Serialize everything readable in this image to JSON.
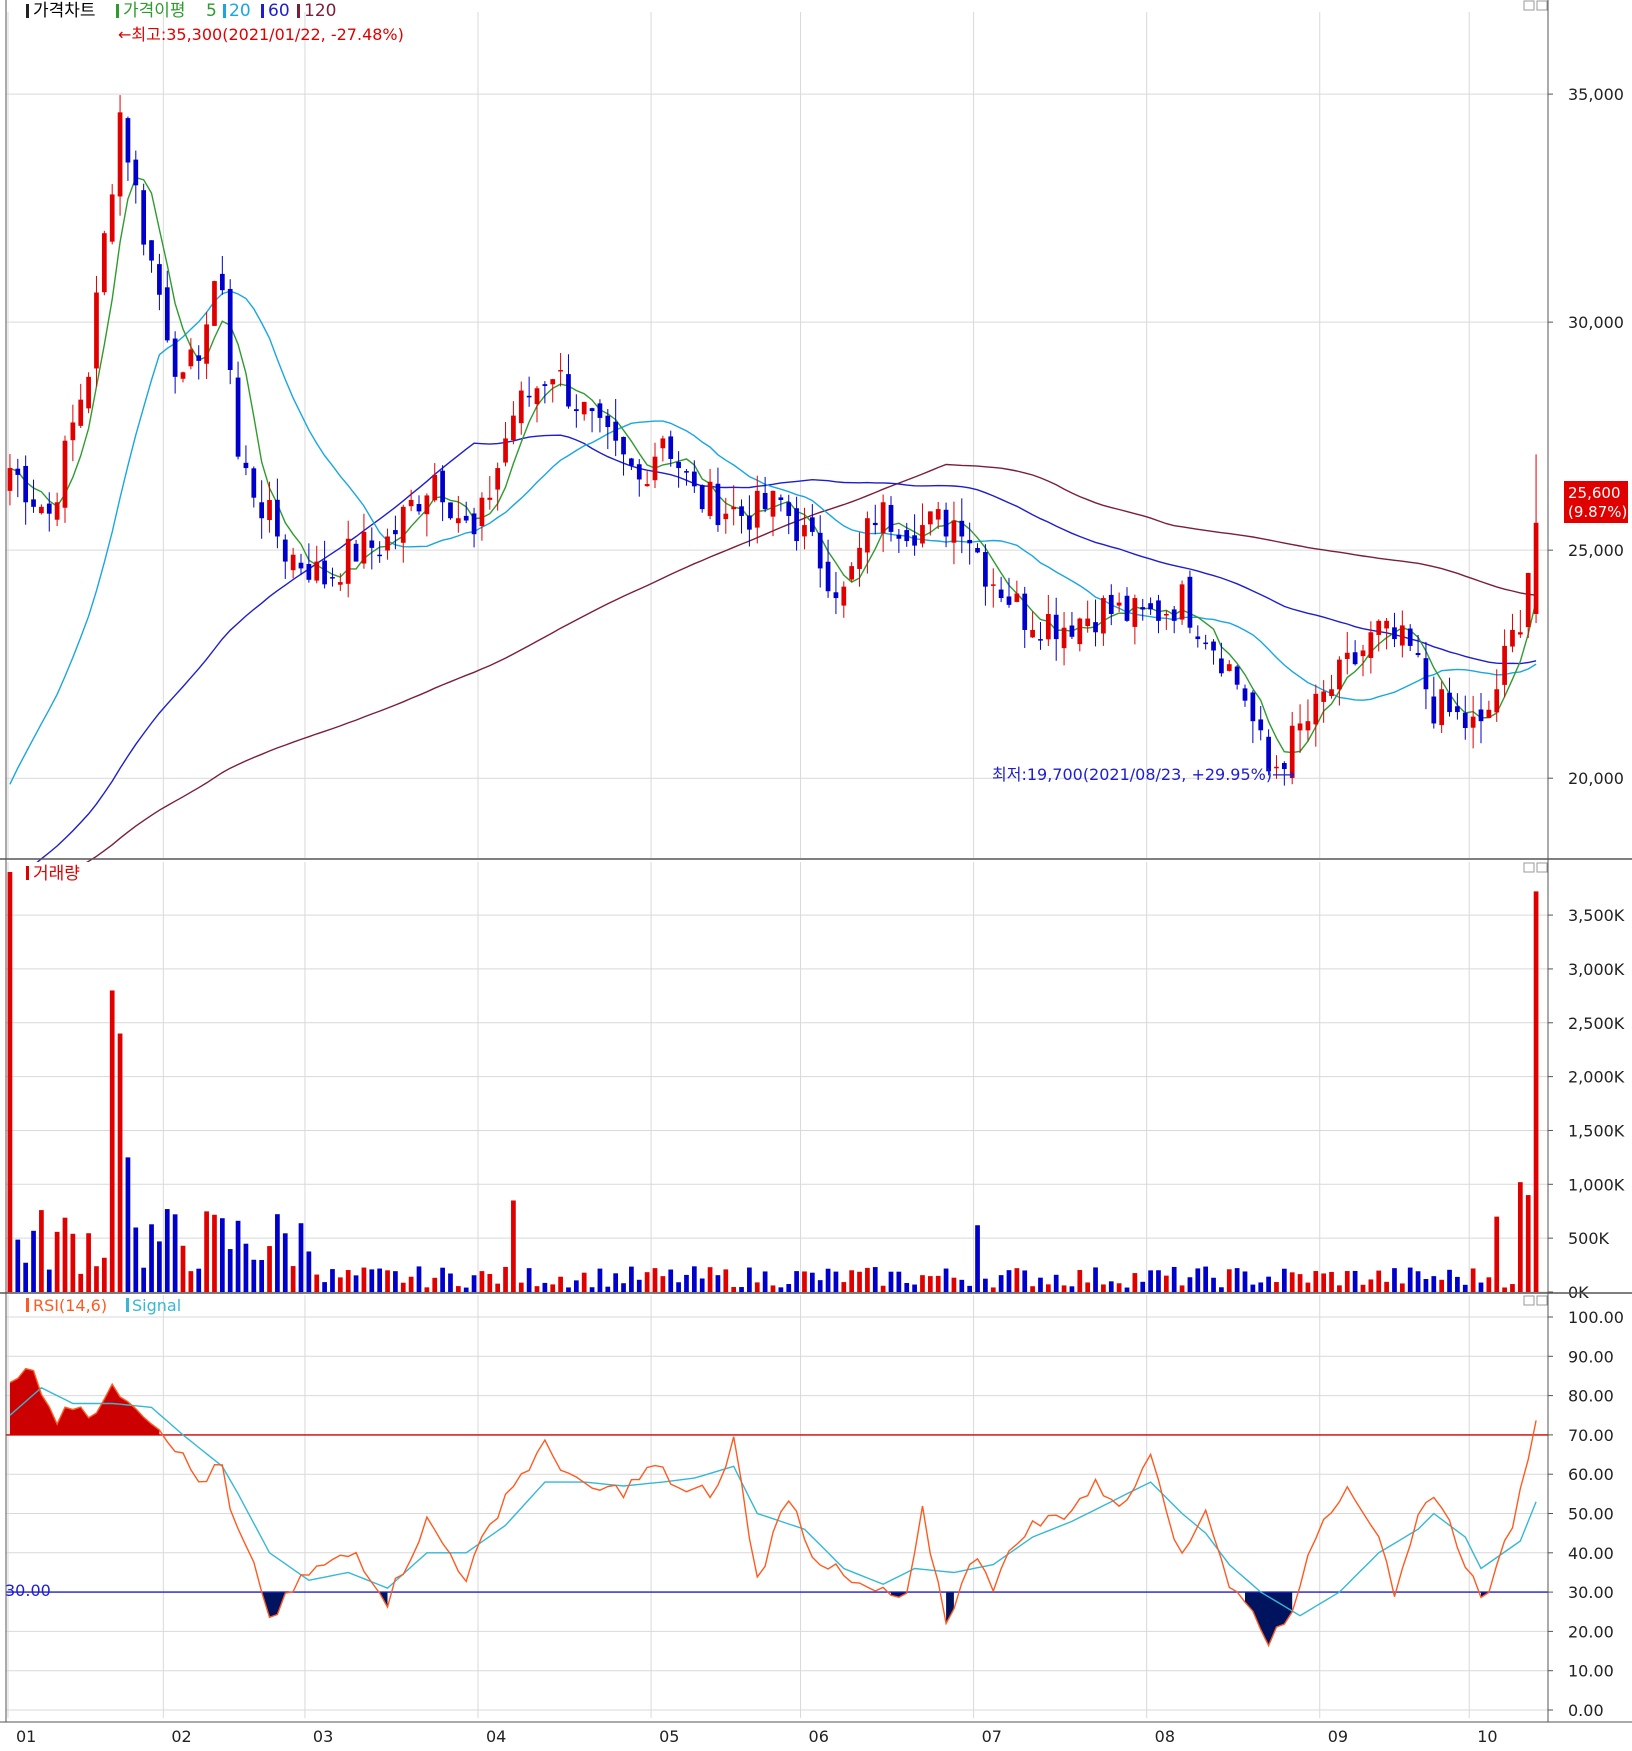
{
  "colors": {
    "up": "#e00000",
    "down": "#0000cc",
    "ma5": "#2e9b2e",
    "ma20": "#1aa6e0",
    "ma60": "#1e1ed0",
    "ma120": "#7a1f3a",
    "grid": "#d9d9d9",
    "frame": "#555555",
    "rsi": "#ff5a1f",
    "signal": "#35b8d6",
    "rsi_high": "#cc0000",
    "rsi_low": "#00135e",
    "axis_text": "#222222"
  },
  "price_panel": {
    "legend": {
      "title": "가격차트",
      "ma_label": "가격이평",
      "ma5": "5",
      "ma20": "20",
      "ma60": "60",
      "ma120": "120"
    },
    "high_annotation": "←최고:35,300(2021/01/22, -27.48%)",
    "low_annotation": "최저:19,700(2021/08/23, +29.95%)⟶",
    "current_price": "25,600",
    "current_change": "(9.87%)"
  },
  "volume_panel": {
    "title": "거래량"
  },
  "rsi_panel": {
    "legend_rsi": "RSI(14,6)",
    "legend_signal": "Signal",
    "low_line_label": "30.00"
  },
  "chart_data": [
    {
      "type": "candlestick",
      "title": "가격차트",
      "ylim": [
        18250,
        36800
      ],
      "y_ticks": [
        "35,000",
        "30,000",
        "25,000",
        "20,000"
      ],
      "x_ticks": [
        "01",
        "02",
        "03",
        "04",
        "05",
        "06",
        "07",
        "08",
        "09",
        "10"
      ],
      "x_tick_dates": [
        "2021-01",
        "2021-02",
        "2021-03",
        "2021-04",
        "2021-05",
        "2021-06",
        "2021-07",
        "2021-08",
        "2021-09",
        "2021-10"
      ],
      "close_anchors": [
        [
          "2021-01-04",
          26800
        ],
        [
          "2021-01-11",
          25800
        ],
        [
          "2021-01-18",
          29000
        ],
        [
          "2021-01-22",
          34600
        ],
        [
          "2021-01-27",
          32000
        ],
        [
          "2021-02-03",
          28500
        ],
        [
          "2021-02-10",
          31000
        ],
        [
          "2021-02-16",
          27000
        ],
        [
          "2021-02-24",
          25000
        ],
        [
          "2021-03-04",
          24400
        ],
        [
          "2021-03-10",
          25000
        ],
        [
          "2021-03-16",
          25200
        ],
        [
          "2021-03-24",
          26700
        ],
        [
          "2021-03-31",
          25200
        ],
        [
          "2021-04-07",
          28000
        ],
        [
          "2021-04-14",
          29000
        ],
        [
          "2021-04-22",
          27500
        ],
        [
          "2021-04-29",
          26500
        ],
        [
          "2021-05-04",
          27600
        ],
        [
          "2021-05-11",
          26200
        ],
        [
          "2021-05-20",
          25800
        ],
        [
          "2021-05-27",
          26000
        ],
        [
          "2021-06-03",
          24800
        ],
        [
          "2021-06-08",
          24000
        ],
        [
          "2021-06-14",
          25800
        ],
        [
          "2021-06-22",
          25500
        ],
        [
          "2021-06-29",
          25700
        ],
        [
          "2021-07-02",
          24600
        ],
        [
          "2021-07-09",
          23600
        ],
        [
          "2021-07-16",
          23400
        ],
        [
          "2021-07-23",
          23700
        ],
        [
          "2021-07-30",
          23500
        ],
        [
          "2021-08-06",
          23900
        ],
        [
          "2021-08-12",
          23000
        ],
        [
          "2021-08-18",
          21800
        ],
        [
          "2021-08-23",
          20100
        ],
        [
          "2021-08-31",
          21500
        ],
        [
          "2021-09-03",
          22200
        ],
        [
          "2021-09-10",
          23200
        ],
        [
          "2021-09-16",
          22800
        ],
        [
          "2021-09-24",
          21600
        ],
        [
          "2021-09-30",
          21200
        ],
        [
          "2021-10-05",
          21000
        ],
        [
          "2021-10-07",
          22000
        ],
        [
          "2021-10-12",
          23600
        ],
        [
          "2021-10-14",
          25600
        ]
      ],
      "series": [
        {
          "name": "5",
          "values": []
        },
        {
          "name": "20",
          "values": []
        },
        {
          "name": "60",
          "values": []
        },
        {
          "name": "120",
          "values": []
        }
      ]
    },
    {
      "type": "bar",
      "title": "거래량",
      "ylim": [
        0,
        3900000
      ],
      "y_ticks": [
        "3,500K",
        "3,000K",
        "2,500K",
        "2,000K",
        "1,500K",
        "1,000K",
        "500K",
        "0K"
      ],
      "notable_values": [
        [
          "2021-01-04",
          3900000
        ],
        [
          "2021-01-21",
          2800000
        ],
        [
          "2021-01-22",
          2400000
        ],
        [
          "2021-01-25",
          1250000
        ],
        [
          "2021-04-07",
          850000
        ],
        [
          "2021-07-01",
          620000
        ],
        [
          "2021-10-07",
          700000
        ],
        [
          "2021-10-12",
          1020000
        ],
        [
          "2021-10-13",
          900000
        ],
        [
          "2021-10-14",
          3720000
        ]
      ]
    },
    {
      "type": "line",
      "title": "RSI(14,6)",
      "ylim": [
        0,
        100
      ],
      "y_ticks": [
        "100.00",
        "90.00",
        "80.00",
        "70.00",
        "60.00",
        "50.00",
        "40.00",
        "30.00",
        "20.00",
        "10.00",
        "0.00"
      ],
      "reference_lines": [
        70,
        30
      ],
      "rsi_anchors": [
        [
          "2021-01-04",
          82
        ],
        [
          "2021-01-06",
          86
        ],
        [
          "2021-01-07",
          86
        ],
        [
          "2021-01-12",
          74
        ],
        [
          "2021-01-15",
          79
        ],
        [
          "2021-01-18",
          75
        ],
        [
          "2021-01-21",
          81
        ],
        [
          "2021-01-25",
          80
        ],
        [
          "2021-01-28",
          74
        ],
        [
          "2021-02-01",
          70
        ],
        [
          "2021-02-05",
          58
        ],
        [
          "2021-02-10",
          62
        ],
        [
          "2021-02-15",
          50
        ],
        [
          "2021-02-19",
          31
        ],
        [
          "2021-02-22",
          23
        ],
        [
          "2021-03-02",
          35
        ],
        [
          "2021-03-10",
          40
        ],
        [
          "2021-03-16",
          28
        ],
        [
          "2021-03-23",
          48
        ],
        [
          "2021-03-30",
          34
        ],
        [
          "2021-04-06",
          55
        ],
        [
          "2021-04-13",
          67
        ],
        [
          "2021-04-20",
          56
        ],
        [
          "2021-04-27",
          56
        ],
        [
          "2021-05-03",
          62
        ],
        [
          "2021-05-10",
          55
        ],
        [
          "2021-05-14",
          56
        ],
        [
          "2021-05-18",
          69
        ],
        [
          "2021-05-24",
          33
        ],
        [
          "2021-05-28",
          55
        ],
        [
          "2021-06-02",
          40
        ],
        [
          "2021-06-09",
          32
        ],
        [
          "2021-06-14",
          30
        ],
        [
          "2021-06-18",
          28
        ],
        [
          "2021-06-22",
          50
        ],
        [
          "2021-06-25",
          23
        ],
        [
          "2021-07-01",
          40
        ],
        [
          "2021-07-05",
          32
        ],
        [
          "2021-07-09",
          46
        ],
        [
          "2021-07-16",
          50
        ],
        [
          "2021-07-22",
          57
        ],
        [
          "2021-07-28",
          52
        ],
        [
          "2021-08-02",
          67
        ],
        [
          "2021-08-06",
          38
        ],
        [
          "2021-08-11",
          52
        ],
        [
          "2021-08-16",
          32
        ],
        [
          "2021-08-20",
          22
        ],
        [
          "2021-08-23",
          17
        ],
        [
          "2021-08-27",
          30
        ],
        [
          "2021-08-31",
          45
        ],
        [
          "2021-09-06",
          58
        ],
        [
          "2021-09-10",
          45
        ],
        [
          "2021-09-14",
          27
        ],
        [
          "2021-09-17",
          48
        ],
        [
          "2021-09-24",
          56
        ],
        [
          "2021-09-30",
          38
        ],
        [
          "2021-10-05",
          28
        ],
        [
          "2021-10-07",
          35
        ],
        [
          "2021-10-12",
          55
        ],
        [
          "2021-10-14",
          75
        ]
      ],
      "signal_anchors": [
        [
          "2021-01-04",
          75
        ],
        [
          "2021-01-08",
          82
        ],
        [
          "2021-01-14",
          78
        ],
        [
          "2021-01-21",
          78
        ],
        [
          "2021-01-28",
          77
        ],
        [
          "2021-02-03",
          70
        ],
        [
          "2021-02-10",
          62
        ],
        [
          "2021-02-16",
          55
        ],
        [
          "2021-02-22",
          40
        ],
        [
          "2021-03-01",
          33
        ],
        [
          "2021-03-09",
          35
        ],
        [
          "2021-03-16",
          31
        ],
        [
          "2021-03-23",
          40
        ],
        [
          "2021-03-30",
          40
        ],
        [
          "2021-04-06",
          47
        ],
        [
          "2021-04-13",
          58
        ],
        [
          "2021-04-20",
          58
        ],
        [
          "2021-04-27",
          57
        ],
        [
          "2021-05-04",
          58
        ],
        [
          "2021-05-11",
          59
        ],
        [
          "2021-05-18",
          62
        ],
        [
          "2021-05-24",
          50
        ],
        [
          "2021-06-01",
          46
        ],
        [
          "2021-06-08",
          36
        ],
        [
          "2021-06-15",
          32
        ],
        [
          "2021-06-21",
          36
        ],
        [
          "2021-06-28",
          35
        ],
        [
          "2021-07-05",
          37
        ],
        [
          "2021-07-12",
          44
        ],
        [
          "2021-07-19",
          48
        ],
        [
          "2021-07-26",
          53
        ],
        [
          "2021-08-02",
          58
        ],
        [
          "2021-08-06",
          50
        ],
        [
          "2021-08-11",
          45
        ],
        [
          "2021-08-16",
          37
        ],
        [
          "2021-08-20",
          30
        ],
        [
          "2021-08-27",
          24
        ],
        [
          "2021-09-03",
          30
        ],
        [
          "2021-09-10",
          40
        ],
        [
          "2021-09-17",
          46
        ],
        [
          "2021-09-24",
          50
        ],
        [
          "2021-09-30",
          44
        ],
        [
          "2021-10-05",
          36
        ],
        [
          "2021-10-12",
          43
        ],
        [
          "2021-10-14",
          53
        ]
      ]
    }
  ]
}
